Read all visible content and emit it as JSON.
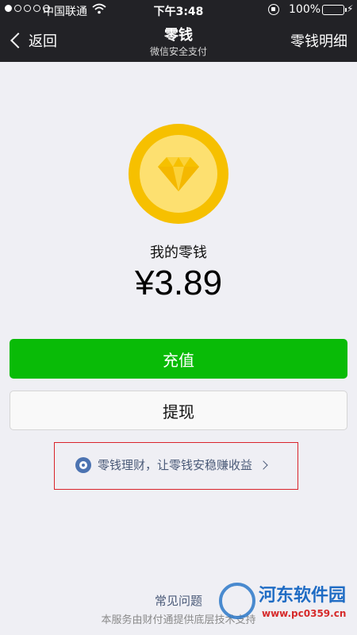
{
  "status_bar": {
    "carrier": "中国联通",
    "time": "下午3:48",
    "battery": "100%",
    "icons": [
      "signal-dots-icon",
      "wifi-icon",
      "rotation-lock-icon",
      "battery-icon",
      "charging-bolt-icon"
    ]
  },
  "nav": {
    "back_label": "返回",
    "title": "零钱",
    "subtitle": "微信安全支付",
    "right_label": "零钱明细"
  },
  "wallet": {
    "icon": "diamond-coin-icon",
    "balance_label": "我的零钱",
    "balance_value": "¥3.89"
  },
  "actions": {
    "recharge_label": "充值",
    "withdraw_label": "提现"
  },
  "promo": {
    "text": "零钱理财，让零钱安稳赚收益"
  },
  "footer": {
    "faq": "常见问题",
    "service_note": "本服务由财付通提供底层技术支持"
  },
  "watermark": {
    "name": "河东软件园",
    "url": "www.pc0359.cn"
  },
  "colors": {
    "nav_bg": "#222226",
    "page_bg": "#efeff4",
    "primary_green": "#09bb07",
    "coin_outer": "#f6c000",
    "coin_inner": "#fde070",
    "link_blue": "#4a5a78",
    "highlight_red": "#d9232a"
  }
}
